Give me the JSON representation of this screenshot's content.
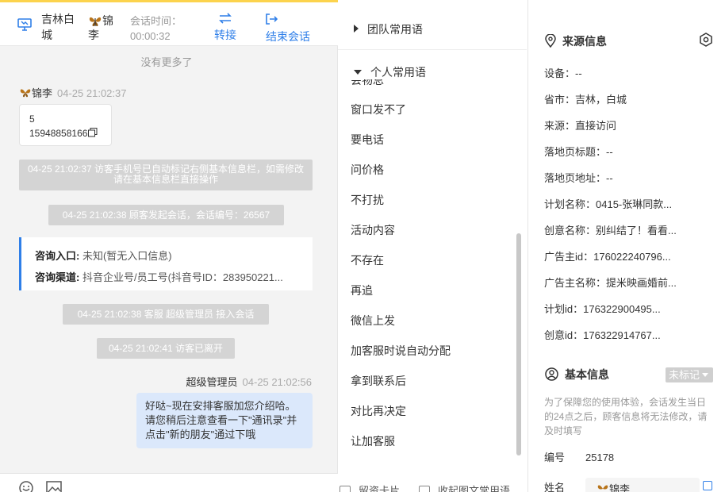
{
  "topbar": {
    "location": "吉林白城",
    "visitor_name": "锦李",
    "session_time_label": "会话时间：",
    "session_time_value": "00:00:32",
    "transfer_label": "转接",
    "end_session_label": "结束会话"
  },
  "chat": {
    "no_more": "没有更多了",
    "visitor_message": {
      "sender": "锦李",
      "time": "04-25 21:02:37",
      "line1": "5",
      "line2": "15948858166"
    },
    "system_messages": [
      "04-25 21:02:37 访客手机号已自动标记右侧基本信息栏，如需修改请在基本信息栏直接操作",
      "04-25 21:02:38 顾客发起会话，会话编号：26567",
      "04-25 21:02:38 客服 超级管理员 接入会话",
      "04-25 21:02:41 访客已离开"
    ],
    "consult_card": {
      "entry_label": "咨询入口:",
      "entry_value": " 未知(暂无入口信息)",
      "channel_label": "咨询渠道:",
      "channel_value": " 抖音企业号/员工号(抖音号ID：283950221..."
    },
    "agent_message": {
      "sender": "超级管理员",
      "time": "04-25 21:02:56",
      "text": "好哒~现在安排客服加您介绍哈。请您稍后注意查看一下\"通讯录\"并点击\"新的朋友\"通过下哦"
    }
  },
  "quick_replies": {
    "team_group": "团队常用语",
    "personal_group": "个人常用语",
    "partial_item": "会物总",
    "items": [
      "窗口发不了",
      "要电话",
      "问价格",
      "不打扰",
      "活动内容",
      "不存在",
      "再追",
      "微信上发",
      "加客服时说自动分配",
      "拿到联系后",
      "对比再决定",
      "让加客服"
    ],
    "footer_left": "留资卡片",
    "footer_right": "收起图文常用语"
  },
  "source_info": {
    "title": "来源信息",
    "fields": [
      "设备：--",
      "省市：吉林，白城",
      "来源：直接访问",
      "落地页标题：--",
      "落地页地址：--",
      "计划名称：0415-张琳同款...",
      "创意名称：别纠结了！看看...",
      "广告主id：176022240796...",
      "广告主名称：提米映画婚前...",
      "计划id：176322900495...",
      "创意id：176322914767..."
    ]
  },
  "basic_info": {
    "title": "基本信息",
    "tag_button": "未标记",
    "notice": "为了保障您的使用体验，会话发生当日的24点之后，顾客信息将无法修改，请及时填写",
    "number_label": "编号",
    "number_value": "25178",
    "name_label": "姓名",
    "name_value": "锦李"
  },
  "colors": {
    "accent": "#2f7fe8",
    "bubble": "#dbe8fb",
    "system_pill": "#d4d4d4",
    "top_border": "#fcd34d"
  }
}
